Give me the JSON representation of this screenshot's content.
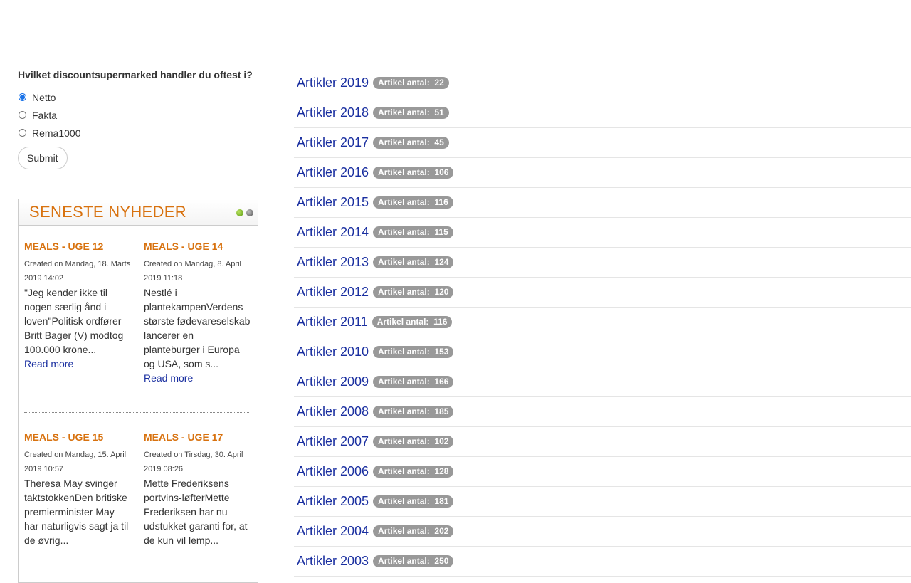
{
  "poll": {
    "question": "Hvilket discountsupermarked handler du oftest i?",
    "options": [
      {
        "label": "Netto",
        "checked": true
      },
      {
        "label": "Fakta",
        "checked": false
      },
      {
        "label": "Rema1000",
        "checked": false
      }
    ],
    "submit_label": "Submit"
  },
  "news": {
    "title": "SENESTE NYHEDER",
    "items": [
      {
        "title": "MEALS - UGE 12",
        "created": "Created on Mandag, 18. Marts 2019 14:02",
        "intro": "\"Jeg kender ikke til nogen særlig ånd i loven\"Politisk ordfører Britt Bager (V) modtog 100.000 krone...",
        "read_more": "Read more"
      },
      {
        "title": "MEALS - UGE 14",
        "created": "Created on Mandag, 8. April 2019 11:18",
        "intro": "Nestlé i plantekampenVerdens største fødevareselskab lancerer en planteburger i Europa og USA, som s...",
        "read_more": "Read more"
      },
      {
        "title": "MEALS - UGE 15",
        "created": "Created on Mandag, 15. April 2019 10:57",
        "intro": "Theresa May svinger taktstokkenDen britiske premierminister May har naturligvis sagt ja til de øvrig..."
      },
      {
        "title": "MEALS - UGE 17",
        "created": "Created on Tirsdag, 30. April 2019 08:26",
        "intro": "Mette Frederiksens portvins-løfterMette Frederiksen har nu udstukket garanti for, at de kun vil lemp..."
      }
    ]
  },
  "archive": {
    "badge_prefix": "Artikel antal:",
    "rows": [
      {
        "label": "Artikler 2019",
        "count": "22"
      },
      {
        "label": "Artikler 2018",
        "count": "51"
      },
      {
        "label": "Artikler 2017",
        "count": "45"
      },
      {
        "label": "Artikler 2016",
        "count": "106"
      },
      {
        "label": "Artikler 2015",
        "count": "116"
      },
      {
        "label": "Artikler 2014",
        "count": "115"
      },
      {
        "label": "Artikler 2013",
        "count": "124"
      },
      {
        "label": "Artikler 2012",
        "count": "120"
      },
      {
        "label": "Artikler 2011",
        "count": "116"
      },
      {
        "label": "Artikler 2010",
        "count": "153"
      },
      {
        "label": "Artikler 2009",
        "count": "166"
      },
      {
        "label": "Artikler 2008",
        "count": "185"
      },
      {
        "label": "Artikler 2007",
        "count": "102"
      },
      {
        "label": "Artikler 2006",
        "count": "128"
      },
      {
        "label": "Artikler 2005",
        "count": "181"
      },
      {
        "label": "Artikler 2004",
        "count": "202"
      },
      {
        "label": "Artikler 2003",
        "count": "250"
      }
    ]
  },
  "colors": {
    "accent_orange": "#d8720f",
    "link_blue": "#1a2fa0",
    "badge_gray": "#999999",
    "dot_active": "#5a9a12",
    "dot_inactive": "#555555"
  }
}
